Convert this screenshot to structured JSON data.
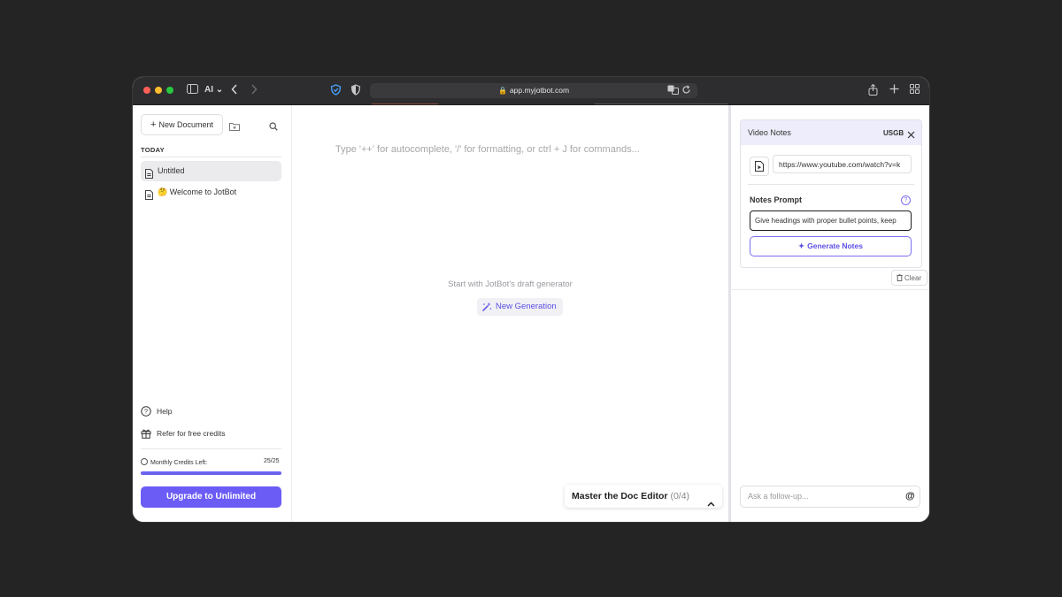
{
  "browser": {
    "profile_label": "AI",
    "url": "app.myjotbot.com"
  },
  "sidebar": {
    "new_document_label": "New Document",
    "section_today": "TODAY",
    "documents": [
      {
        "label": "Untitled",
        "active": true
      },
      {
        "label": "🤔 Welcome to JotBot",
        "active": false
      }
    ],
    "help_label": "Help",
    "refer_label": "Refer for free credits",
    "credits_label": "Monthly Credits Left:",
    "credits_count": "25/25",
    "credits_fraction": 1.0,
    "upgrade_label": "Upgrade to Unlimited"
  },
  "editor": {
    "placeholder": "Type '++' for autocomplete, '/' for formatting, or ctrl + J for commands...",
    "draft_prompt": "Start with JotBot's draft generator",
    "new_generation_label": "New Generation",
    "master_title": "Master the Doc Editor",
    "master_count": "(0/4)"
  },
  "video_notes": {
    "title": "Video Notes",
    "language": "USGB",
    "url_value": "https://www.youtube.com/watch?v=k",
    "notes_prompt_label": "Notes Prompt",
    "help_glyph": "?",
    "prompt_value": "Give headings with proper bullet points, keep",
    "generate_label": "Generate Notes",
    "clear_label": "Clear",
    "followup_placeholder": "Ask a follow-up...",
    "at_glyph": "@"
  },
  "colors": {
    "accent": "#6b5cf6",
    "background": "#242424"
  }
}
